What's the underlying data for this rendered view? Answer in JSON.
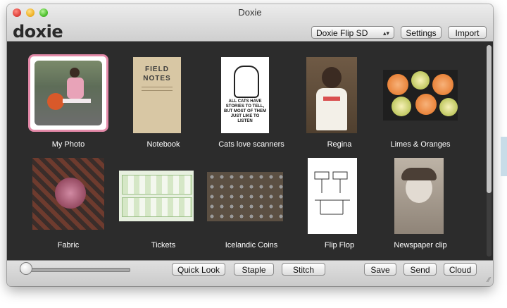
{
  "window": {
    "title": "Doxie"
  },
  "toolbar": {
    "logo": "doxie",
    "device": "Doxie Flip SD",
    "settings_label": "Settings",
    "import_label": "Import"
  },
  "scans": [
    {
      "label": "My Photo"
    },
    {
      "label": "Notebook",
      "thumb_text_1": "FIELD",
      "thumb_text_2": "NOTES"
    },
    {
      "label": "Cats love scanners",
      "thumb_text": "ALL CATS HAVE STORIES TO TELL, BUT MOST OF THEM JUST LIKE TO LISTEN"
    },
    {
      "label": "Regina"
    },
    {
      "label": "Limes & Oranges"
    },
    {
      "label": "Fabric"
    },
    {
      "label": "Tickets"
    },
    {
      "label": "Icelandic Coins"
    },
    {
      "label": "Flip Flop"
    },
    {
      "label": "Newspaper clip"
    }
  ],
  "bottombar": {
    "zoom": 0.0,
    "quicklook_label": "Quick Look",
    "staple_label": "Staple",
    "stitch_label": "Stitch",
    "save_label": "Save",
    "send_label": "Send",
    "cloud_label": "Cloud"
  }
}
